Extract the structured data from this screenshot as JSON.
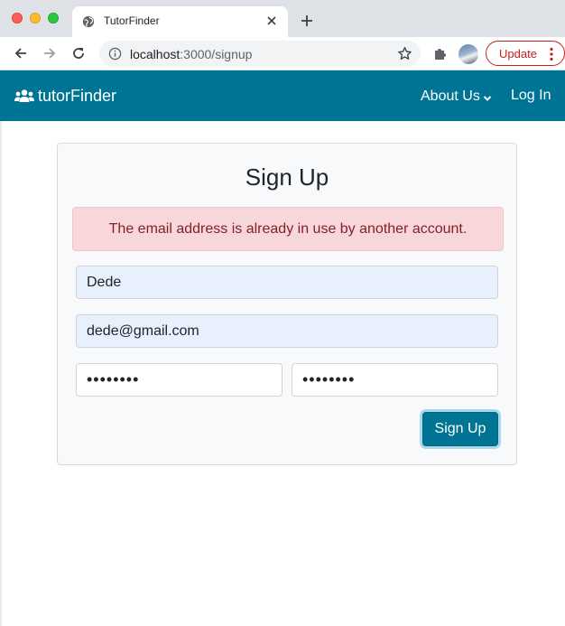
{
  "browser": {
    "tab": {
      "title": "TutorFinder",
      "favicon": "globe-icon"
    },
    "new_tab_icon": "plus-icon",
    "url": {
      "host": "localhost",
      "path": ":3000/signup"
    },
    "update_label": "Update"
  },
  "navbar": {
    "brand": "tutorFinder",
    "brand_icon": "users-icon",
    "about_label": "About Us",
    "login_label": "Log In",
    "color": "#007494"
  },
  "signup": {
    "title": "Sign Up",
    "alert": "The email address is already in use by another account.",
    "name_value": "Dede",
    "email_value": "dede@gmail.com",
    "password_value": "••••••••",
    "confirm_value": "••••••••",
    "submit_label": "Sign Up"
  },
  "colors": {
    "alert_bg": "#f8d7da",
    "alert_text": "#842029",
    "autofill_bg": "#e8f0fe"
  }
}
